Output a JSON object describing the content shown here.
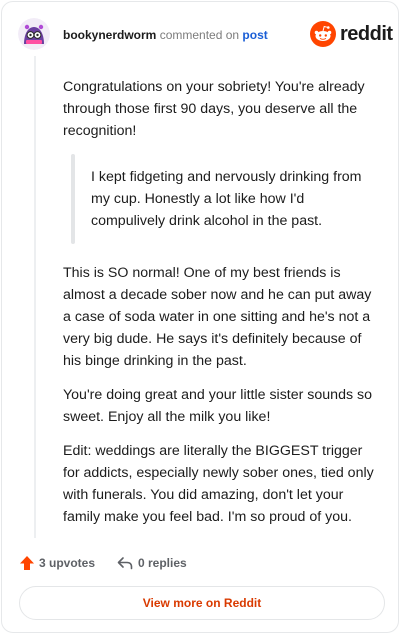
{
  "header": {
    "username": "bookynerdworm",
    "action": " commented on ",
    "target": "post",
    "brand_word": "reddit"
  },
  "comment": {
    "paragraphs_top": [
      "Congratulations on your sobriety! You're already through those first 90 days, you deserve all the recognition!"
    ],
    "quote": "I kept fidgeting and nervously drinking from my cup. Honestly a lot like how I'd compulively drink alcohol in the past.",
    "paragraphs_bottom": [
      "This is SO normal! One of my best friends is almost a decade sober now and he can put away a case of soda water in one sitting and he's not a very big dude. He says it's definitely because of his binge drinking in the past.",
      "You're doing great and your little sister sounds so sweet. Enjoy all the milk you like!",
      "Edit: weddings are literally the BIGGEST trigger for addicts, especially newly sober ones, tied only with funerals. You did amazing, don't let your family make you feel bad. I'm so proud of you."
    ]
  },
  "actions": {
    "upvotes": "3 upvotes",
    "replies": "0 replies",
    "view_more": "View more on Reddit"
  },
  "icons": {
    "avatar": "avatar-image",
    "brand": "reddit-logo-icon",
    "upvote": "upvote-arrow-icon",
    "reply": "reply-arrow-icon"
  },
  "colors": {
    "brand_orange": "#ff4500",
    "link_blue": "#1a5ed6",
    "upvote": "#ff4500",
    "view_more": "#d93a00"
  }
}
